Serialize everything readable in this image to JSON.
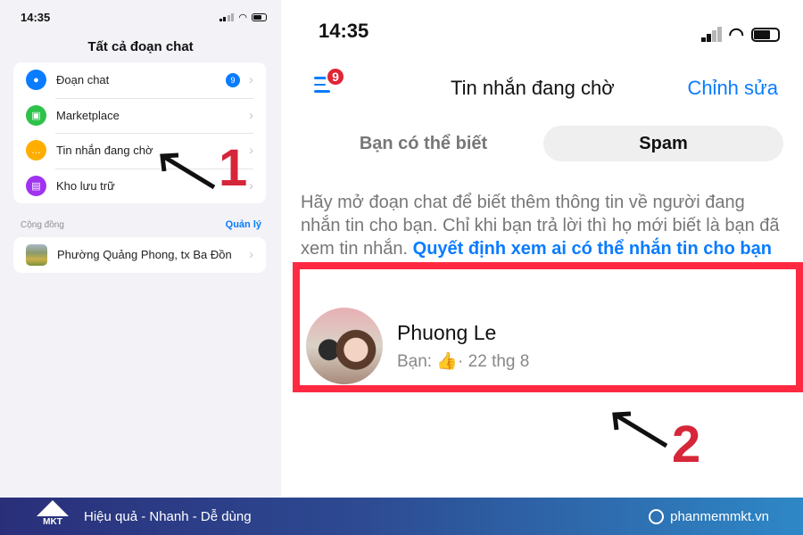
{
  "left": {
    "time": "14:35",
    "title": "Tất cả đoạn chat",
    "items": [
      {
        "label": "Đoạn chat",
        "badge": "9",
        "icon": "chat-bubble-icon",
        "color": "#0a7cff"
      },
      {
        "label": "Marketplace",
        "icon": "store-icon",
        "color": "#2ec24a"
      },
      {
        "label": "Tin nhắn đang chờ",
        "icon": "message-dots-icon",
        "color": "#ffae00"
      },
      {
        "label": "Kho lưu trữ",
        "icon": "archive-icon",
        "color": "#a033f0"
      }
    ],
    "section": "Cộng đồng",
    "manage": "Quản lý",
    "community": "Phường Quảng Phong, tx Ba Đồn",
    "step": "1"
  },
  "right": {
    "time": "14:35",
    "menu_badge": "9",
    "title": "Tin nhắn đang chờ",
    "edit": "Chỉnh sửa",
    "tabs": [
      {
        "label": "Bạn có thể biết"
      },
      {
        "label": "Spam"
      }
    ],
    "info": "Hãy mở đoạn chat để biết thêm thông tin về người đang nhắn tin cho bạn. Chỉ khi bạn trả lời thì họ mới biết là bạn đã xem tin nhắn.",
    "info_link": "Quyết định xem ai có thể nhắn tin cho bạn",
    "person": {
      "name": "Phuong Le",
      "prefix": "Bạn:",
      "emoji": "👍",
      "date": "· 22 thg 8"
    },
    "step": "2"
  },
  "footer": {
    "brand": "MKT",
    "slogan": "Hiệu quả - Nhanh - Dễ dùng",
    "website": "phanmemmkt.vn"
  },
  "colors": {
    "accent": "#0a7cff",
    "highlight": "#ff2a41",
    "step": "#d6263a"
  }
}
